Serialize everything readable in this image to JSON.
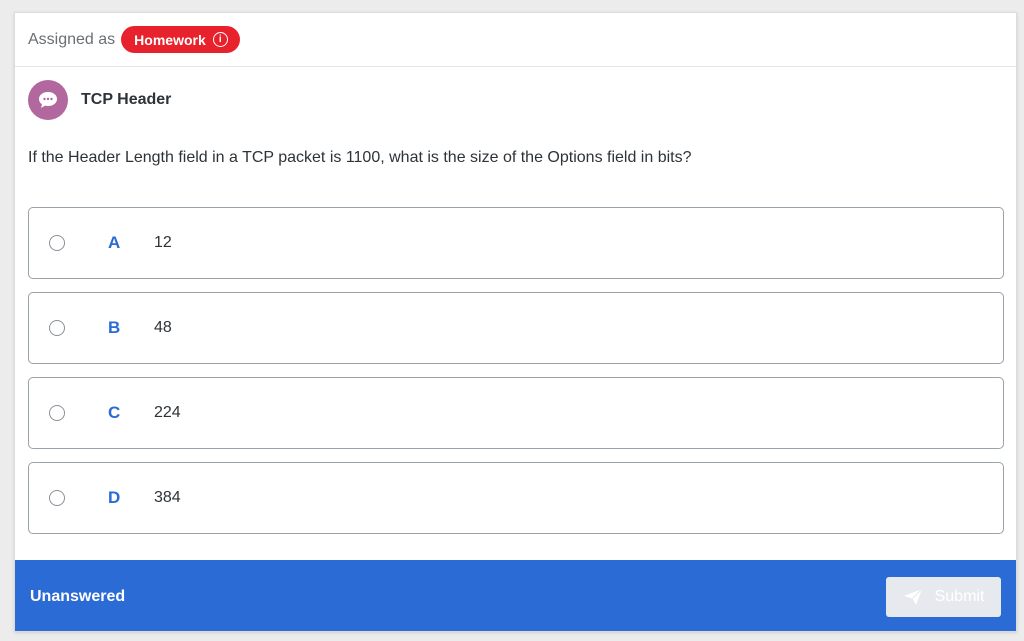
{
  "assignment": {
    "label": "Assigned as",
    "badge": "Homework",
    "badge_color": "#e8222c"
  },
  "question": {
    "title": "TCP Header",
    "text": "If the Header Length field in a TCP packet is 1100, what is the size of the Options field in bits?",
    "options": [
      {
        "letter": "A",
        "value": "12"
      },
      {
        "letter": "B",
        "value": "48"
      },
      {
        "letter": "C",
        "value": "224"
      },
      {
        "letter": "D",
        "value": "384"
      }
    ]
  },
  "footer": {
    "status": "Unanswered",
    "submit_label": "Submit",
    "bar_color": "#2b6bd6"
  },
  "icons": {
    "avatar": "chat-bubble-icon",
    "info": "info-icon",
    "submit": "paper-plane-icon"
  }
}
